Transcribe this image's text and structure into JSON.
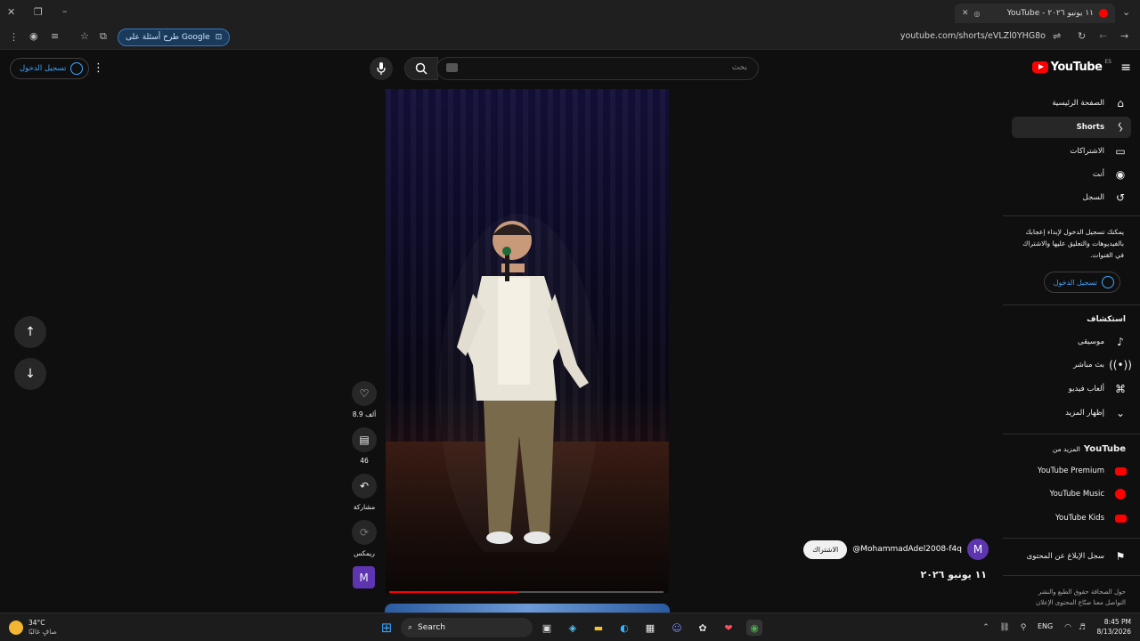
{
  "browser": {
    "tab_title": "YouTube - ١١ يونيو ٢٠٢٦",
    "new_tab_icon": "+",
    "url": "youtube.com/shorts/eVLZl0YHG8o",
    "google_chip": "طرح أسئلة على Google"
  },
  "header": {
    "sign_in": "تسجيل الدخول",
    "search_placeholder": "بحث",
    "logo_text": "YouTube",
    "logo_region": "ES"
  },
  "sidebar": {
    "main": [
      {
        "label": "الصفحة الرئيسية",
        "icon": "home-icon"
      },
      {
        "label": "Shorts",
        "icon": "shorts-icon",
        "active": true
      },
      {
        "label": "الاشتراكات",
        "icon": "subscriptions-icon"
      },
      {
        "label": "أنت",
        "icon": "you-icon"
      },
      {
        "label": "السجل",
        "icon": "history-icon"
      }
    ],
    "signin_prompt": "يمكنك تسجيل الدخول لإبداء إعجابك بالفيديوهات والتعليق عليها والاشتراك في القنوات.",
    "signin_button": "تسجيل الدخول",
    "explore_title": "استكشاف",
    "explore": [
      {
        "label": "موسيقى",
        "icon": "music-icon"
      },
      {
        "label": "بث مباشر",
        "icon": "live-icon"
      },
      {
        "label": "ألعاب فيديو",
        "icon": "gaming-icon"
      },
      {
        "label": "إظهار المزيد",
        "icon": "chevron-down-icon"
      }
    ],
    "more_title_prefix": "المزيد من",
    "more_title_brand": "YouTube",
    "more": [
      {
        "label": "YouTube Premium"
      },
      {
        "label": "YouTube Music"
      },
      {
        "label": "YouTube Kids"
      }
    ],
    "report": "سجل الإبلاغ عن المحتوى",
    "footer_line1": "حول  الصحافة  حقوق الطبع والنشر",
    "footer_line2": "التواصل معنا  صنّاع المحتوى  الإعلان"
  },
  "short": {
    "likes": "8.9 ألف",
    "comments": "46",
    "share": "مشاركة",
    "remix": "ريمكس",
    "channel_handle": "@MohammadAdel2008-f4q",
    "channel_initial": "M",
    "subscribe": "الاشتراك",
    "date": "١١ يونيو ٢٠٢٦",
    "progress": 0.47
  },
  "taskbar": {
    "weather_temp": "34°C",
    "weather_desc": "صافٍ غالبًا",
    "search_label": "Search",
    "lang": "ENG",
    "time": "8:45 PM",
    "date": "8/13/2026"
  },
  "colors": {
    "accent_blue": "#3ea6ff",
    "brand_red": "#ff0000",
    "bg": "#0f0f0f"
  }
}
